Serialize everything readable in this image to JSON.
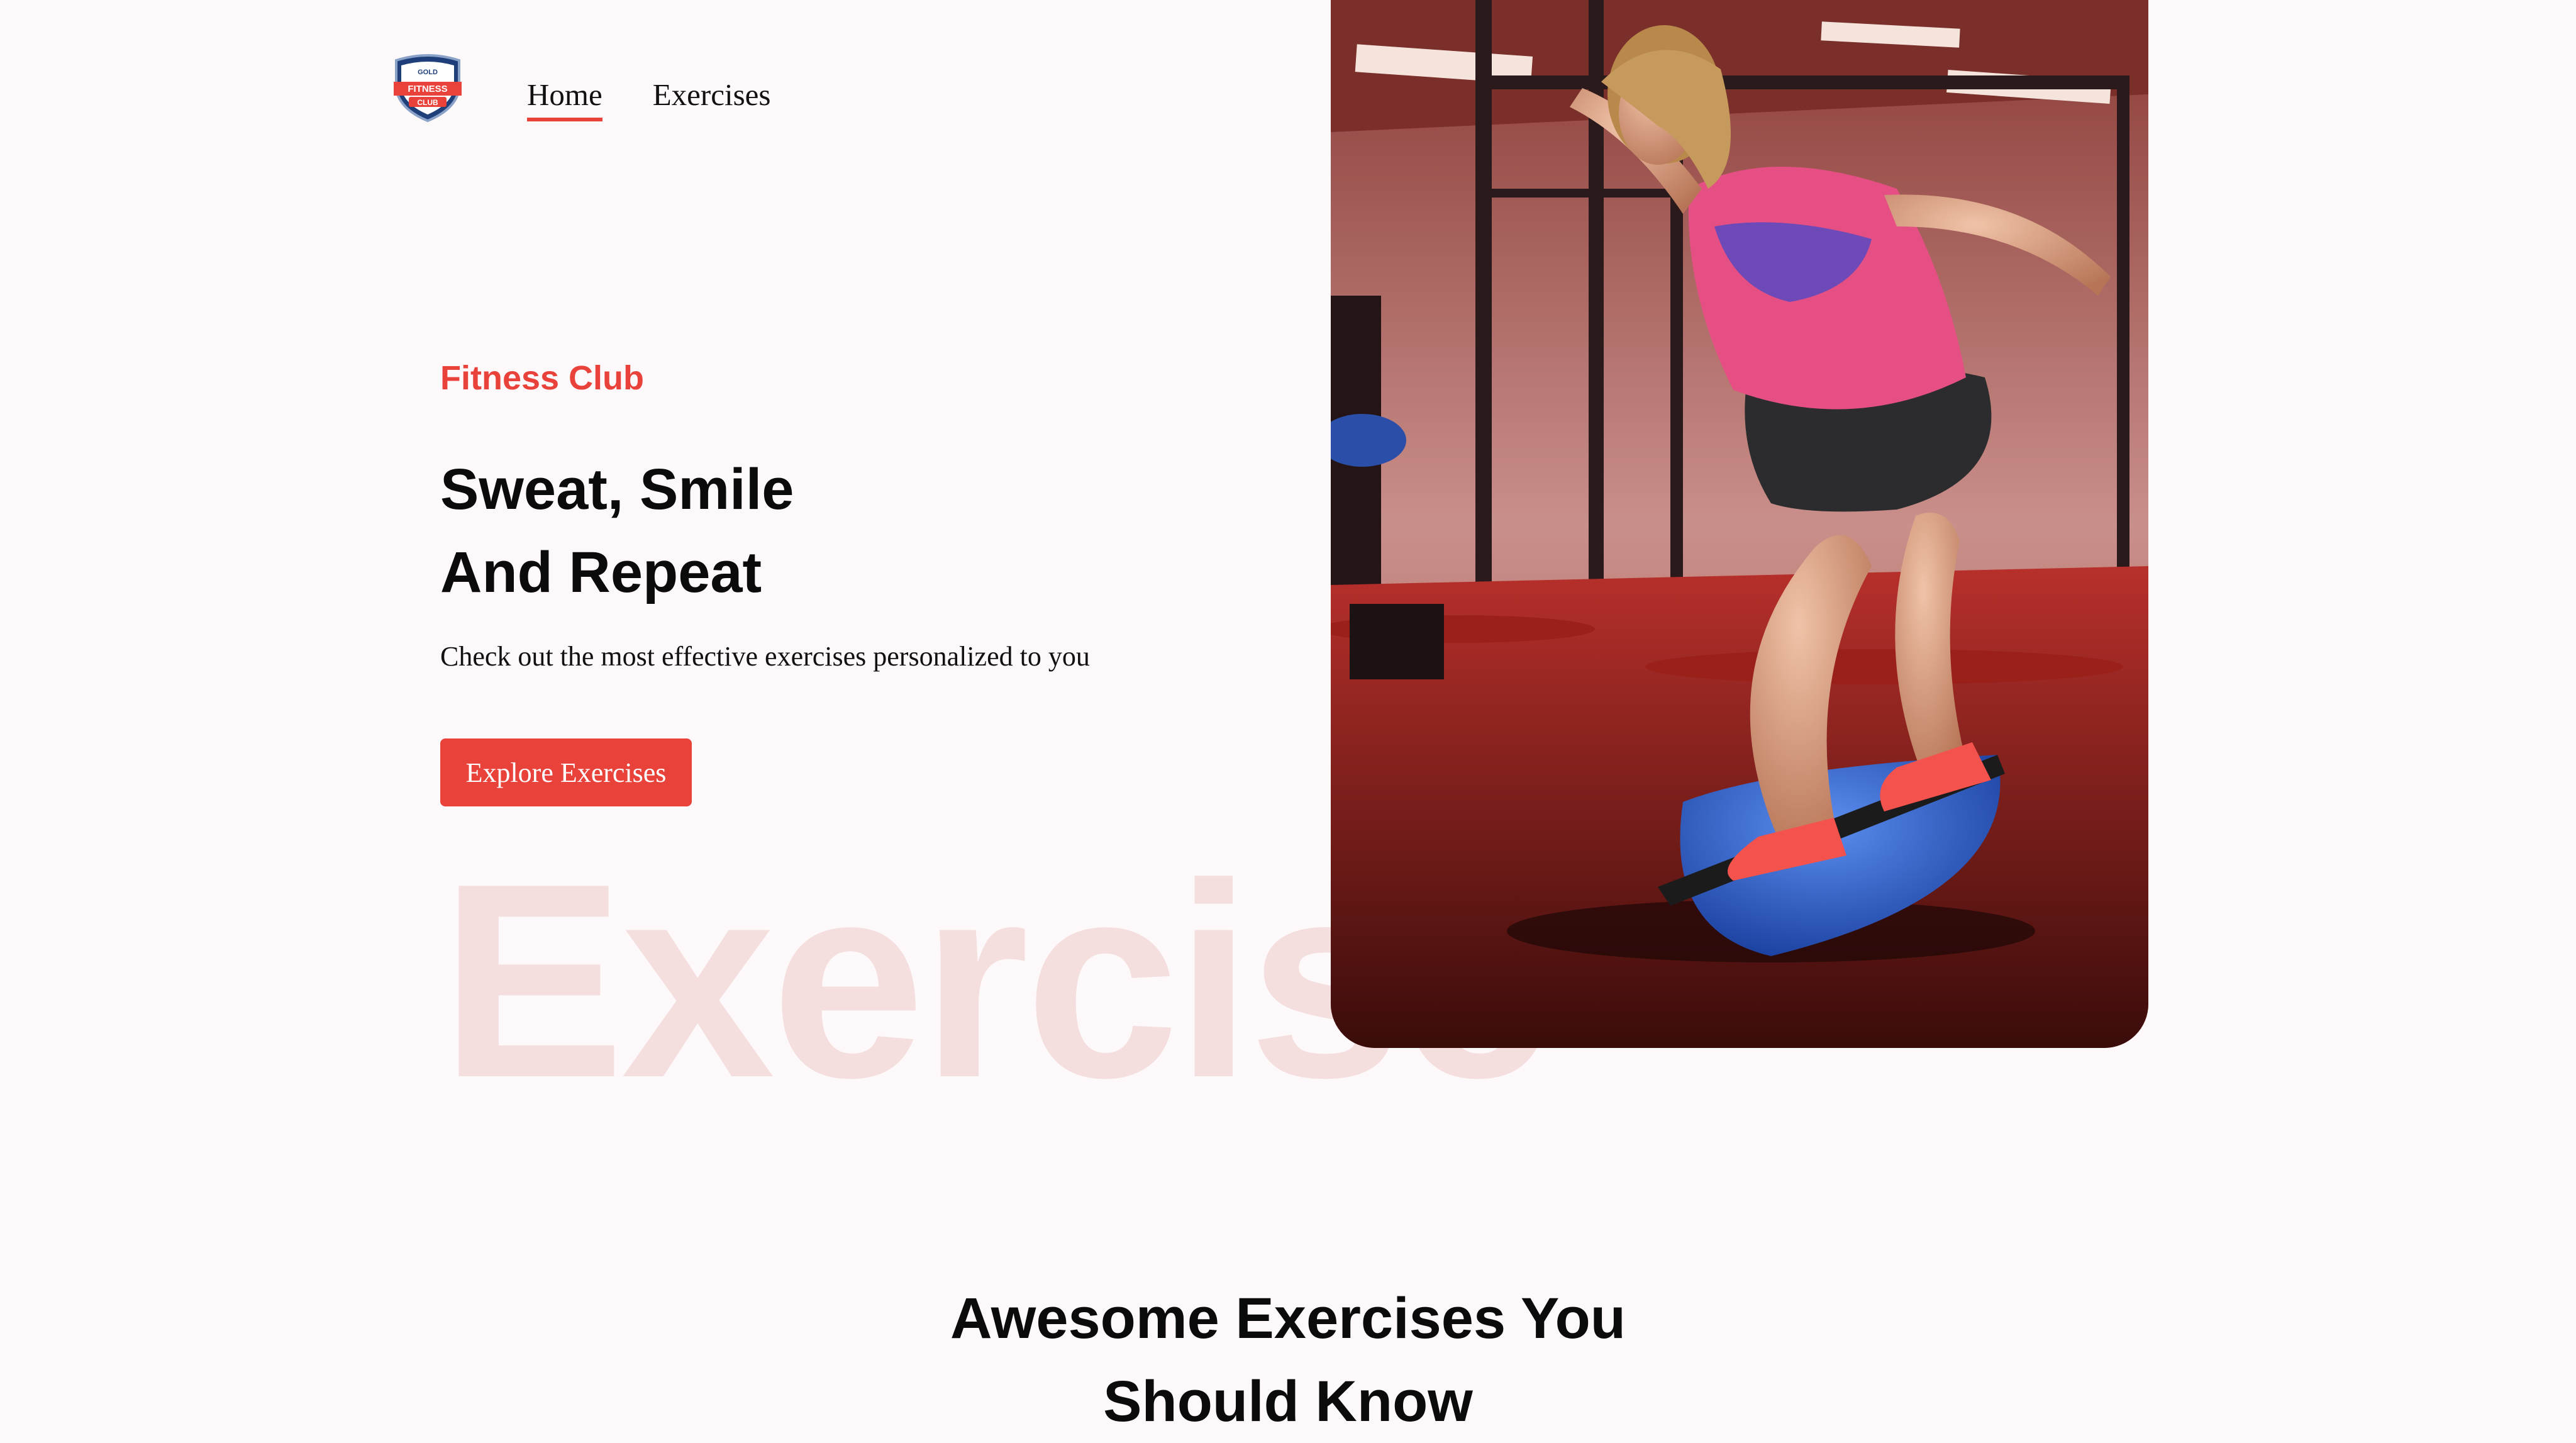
{
  "header": {
    "logo": {
      "top_text": "GOLD",
      "name_line1": "FITNESS",
      "name_line2": "CLUB"
    },
    "nav": [
      {
        "label": "Home",
        "active": true
      },
      {
        "label": "Exercises",
        "active": false
      }
    ]
  },
  "hero": {
    "eyebrow": "Fitness Club",
    "headline_line1": "Sweat, Smile",
    "headline_line2": "And Repeat",
    "subtitle": "Check out the most effective exercises personalized to you",
    "cta_label": "Explore Exercises",
    "watermark": "Exercise",
    "image_icon": "gym-balance-photo"
  },
  "section": {
    "title_line1": "Awesome Exercises You",
    "title_line2": "Should Know"
  },
  "colors": {
    "accent": "#e8423b",
    "background": "#fdf8f9",
    "watermark": "#f4dede",
    "text": "#0b0b0b"
  }
}
